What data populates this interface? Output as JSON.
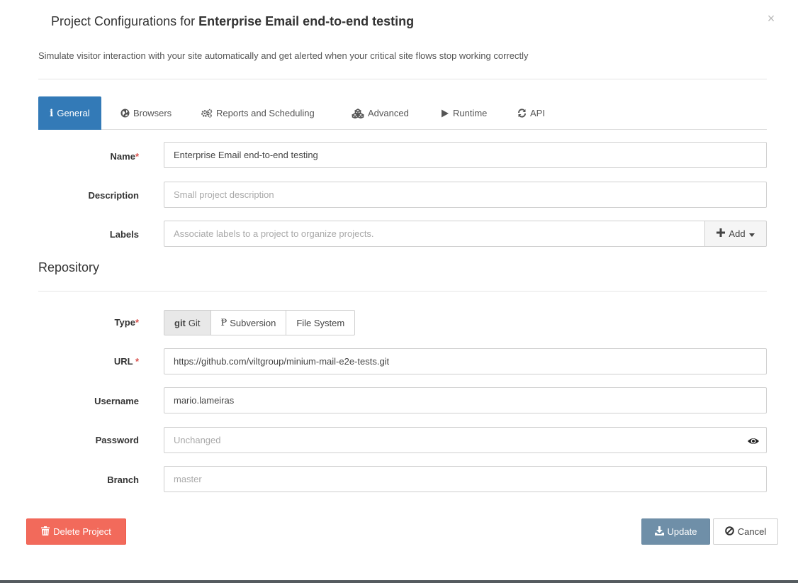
{
  "header": {
    "title_prefix": "Project Configurations for",
    "title_project": "Enterprise Email end-to-end testing",
    "subtitle": "Simulate visitor interaction with your site automatically and get alerted when your critical site flows stop working correctly",
    "close_label": "×"
  },
  "tabs": [
    {
      "label": "General",
      "icon": "info-icon",
      "active": true
    },
    {
      "label": "Browsers",
      "icon": "globe-icon",
      "active": false
    },
    {
      "label": "Reports and Scheduling",
      "icon": "gears-icon",
      "active": false
    },
    {
      "label": "Advanced",
      "icon": "cubes-icon",
      "active": false
    },
    {
      "label": "Runtime",
      "icon": "play-icon",
      "active": false
    },
    {
      "label": "API",
      "icon": "refresh-icon",
      "active": false
    }
  ],
  "general": {
    "name": {
      "label": "Name",
      "required_mark": "*",
      "value": "Enterprise Email end-to-end testing"
    },
    "description": {
      "label": "Description",
      "value": "",
      "placeholder": "Small project description"
    },
    "labels": {
      "label": "Labels",
      "value": "",
      "placeholder": "Associate labels to a project to organize projects.",
      "add_label": "Add"
    }
  },
  "repository": {
    "title": "Repository",
    "type": {
      "label": "Type",
      "required_mark": "*",
      "options": [
        {
          "glyph": "git",
          "label": "Git",
          "active": true
        },
        {
          "glyph": "Ᵽ",
          "label": "Subversion",
          "active": false
        },
        {
          "glyph": "",
          "label": "File System",
          "active": false
        }
      ]
    },
    "url": {
      "label": "URL",
      "required_mark": "*",
      "value": "https://github.com/viltgroup/minium-mail-e2e-tests.git"
    },
    "username": {
      "label": "Username",
      "value": "mario.lameiras"
    },
    "password": {
      "label": "Password",
      "value": "",
      "placeholder": "Unchanged"
    },
    "branch": {
      "label": "Branch",
      "value": "",
      "placeholder": "master"
    }
  },
  "footer": {
    "delete_label": "Delete Project",
    "update_label": "Update",
    "cancel_label": "Cancel"
  },
  "colors": {
    "primary": "#337ab7",
    "danger": "#f26a5b",
    "update": "#6f8fa8",
    "required": "#d9534f"
  }
}
